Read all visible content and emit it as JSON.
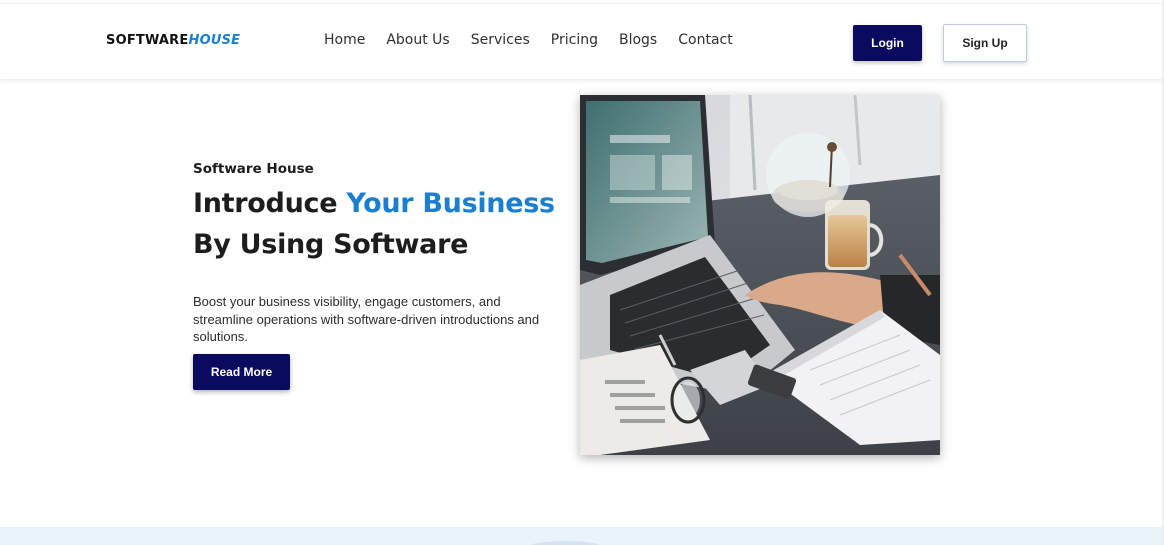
{
  "navbar": {
    "logo_part1": "SOFTWARE",
    "logo_part2": "HOUSE",
    "links": [
      "Home",
      "About Us",
      "Services",
      "Pricing",
      "Blogs",
      "Contact"
    ],
    "login_label": "Login",
    "signup_label": "Sign Up"
  },
  "hero": {
    "eyebrow": "Software House",
    "headline_part1": "Introduce ",
    "headline_accent": "Your Business",
    "headline_line2": "By Using Software",
    "description": "Boost your business visibility, engage customers, and streamline operations with software-driven introductions and solutions.",
    "cta_label": "Read More",
    "image_icon": "laptop-workspace-photo"
  },
  "colors": {
    "brand_dark": "#0a0a5e",
    "accent_blue": "#1a7fd0",
    "section_bg": "#e8f3fa"
  }
}
